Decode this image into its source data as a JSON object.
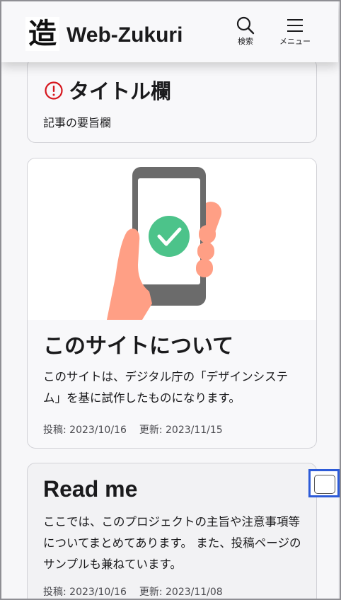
{
  "header": {
    "logo_char": "造",
    "site_name": "Web-Zukuri",
    "search_label": "検索",
    "menu_label": "メニュー"
  },
  "cards": [
    {
      "title": "タイトル欄",
      "summary": "記事の要旨欄"
    },
    {
      "title": "このサイトについて",
      "description": "このサイトは、デジタル庁の「デザインシステム」を基に試作したものになります。",
      "posted": "投稿: 2023/10/16",
      "updated": "更新: 2023/11/15"
    },
    {
      "title": "Read me",
      "description": "ここでは、このプロジェクトの主旨や注意事項等についてまとめてあります。 また、投稿ページのサンプルも兼ねています。",
      "posted": "投稿: 2023/10/16",
      "updated": "更新: 2023/11/08"
    }
  ],
  "colors": {
    "alert": "#d6161d",
    "check": "#4cc38a",
    "hand": "#ff9f85",
    "phone": "#6b6b6b",
    "focus": "#2d5bd8"
  }
}
